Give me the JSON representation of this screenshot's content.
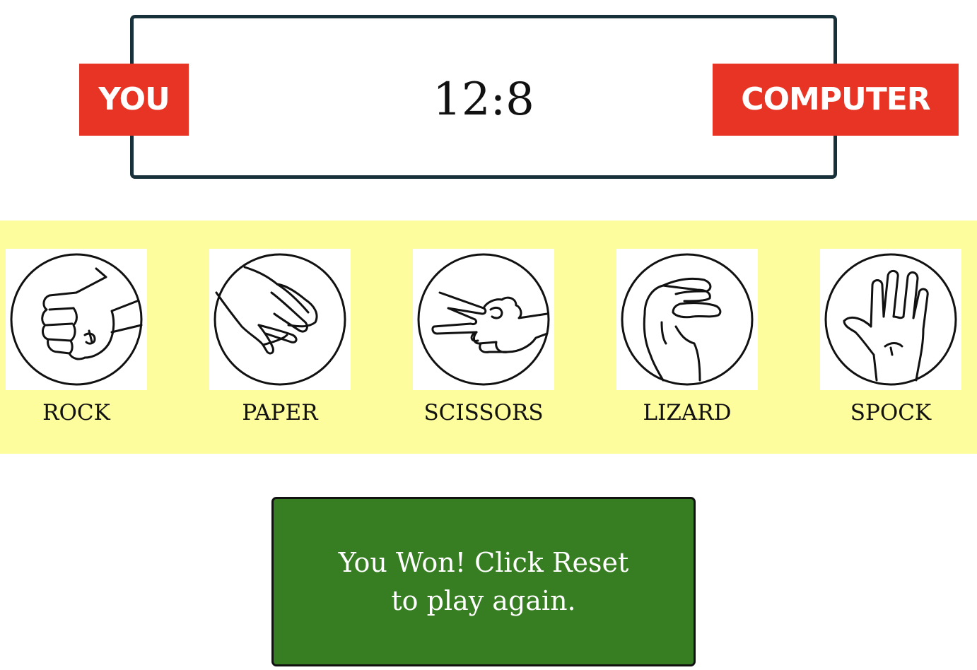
{
  "scoreboard": {
    "player_label": "YOU",
    "computer_label": "COMPUTER",
    "score": "12:8"
  },
  "choices": [
    {
      "label": "ROCK",
      "icon": "rock-hand-icon"
    },
    {
      "label": "PAPER",
      "icon": "paper-hand-icon"
    },
    {
      "label": "SCISSORS",
      "icon": "scissors-hand-icon"
    },
    {
      "label": "LIZARD",
      "icon": "lizard-hand-icon"
    },
    {
      "label": "SPOCK",
      "icon": "spock-hand-icon"
    }
  ],
  "result": {
    "message": "You Won! Click Reset to play again."
  },
  "colors": {
    "badge": "#e83425",
    "choices_bg": "#fdfd9e",
    "result_bg": "#377d22",
    "score_border": "#17303a"
  }
}
